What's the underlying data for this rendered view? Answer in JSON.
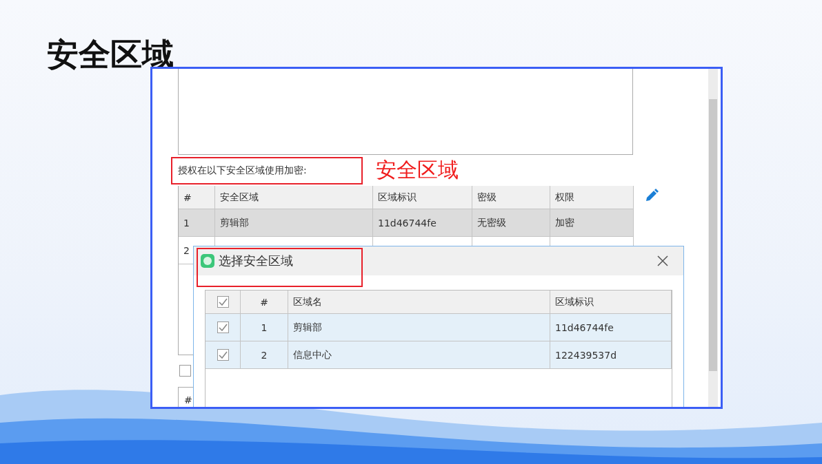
{
  "slide_title": "安全区域",
  "screen": {
    "auth_label": "授权在以下安全区域使用加密:",
    "annotation": "安全区域",
    "zones_table": {
      "columns": [
        "#",
        "安全区域",
        "区域标识",
        "密级",
        "权限"
      ],
      "rows": [
        {
          "cells": [
            "1",
            "剪辑部",
            "11d46744fe",
            "无密级",
            "加密"
          ],
          "selected": true
        },
        {
          "cells": [
            "2"
          ],
          "selected": false
        }
      ]
    },
    "option_checkbox": {
      "checked": false
    },
    "lower_table": {
      "columns": [
        "#"
      ]
    },
    "dialog": {
      "title": "选择安全区域",
      "header_checked": true,
      "columns": [
        "#",
        "区域名",
        "区域标识"
      ],
      "rows": [
        {
          "checked": true,
          "cells": [
            "1",
            "剪辑部",
            "11d46744fe"
          ]
        },
        {
          "checked": true,
          "cells": [
            "2",
            "信息中心",
            "122439537d"
          ]
        }
      ]
    }
  }
}
